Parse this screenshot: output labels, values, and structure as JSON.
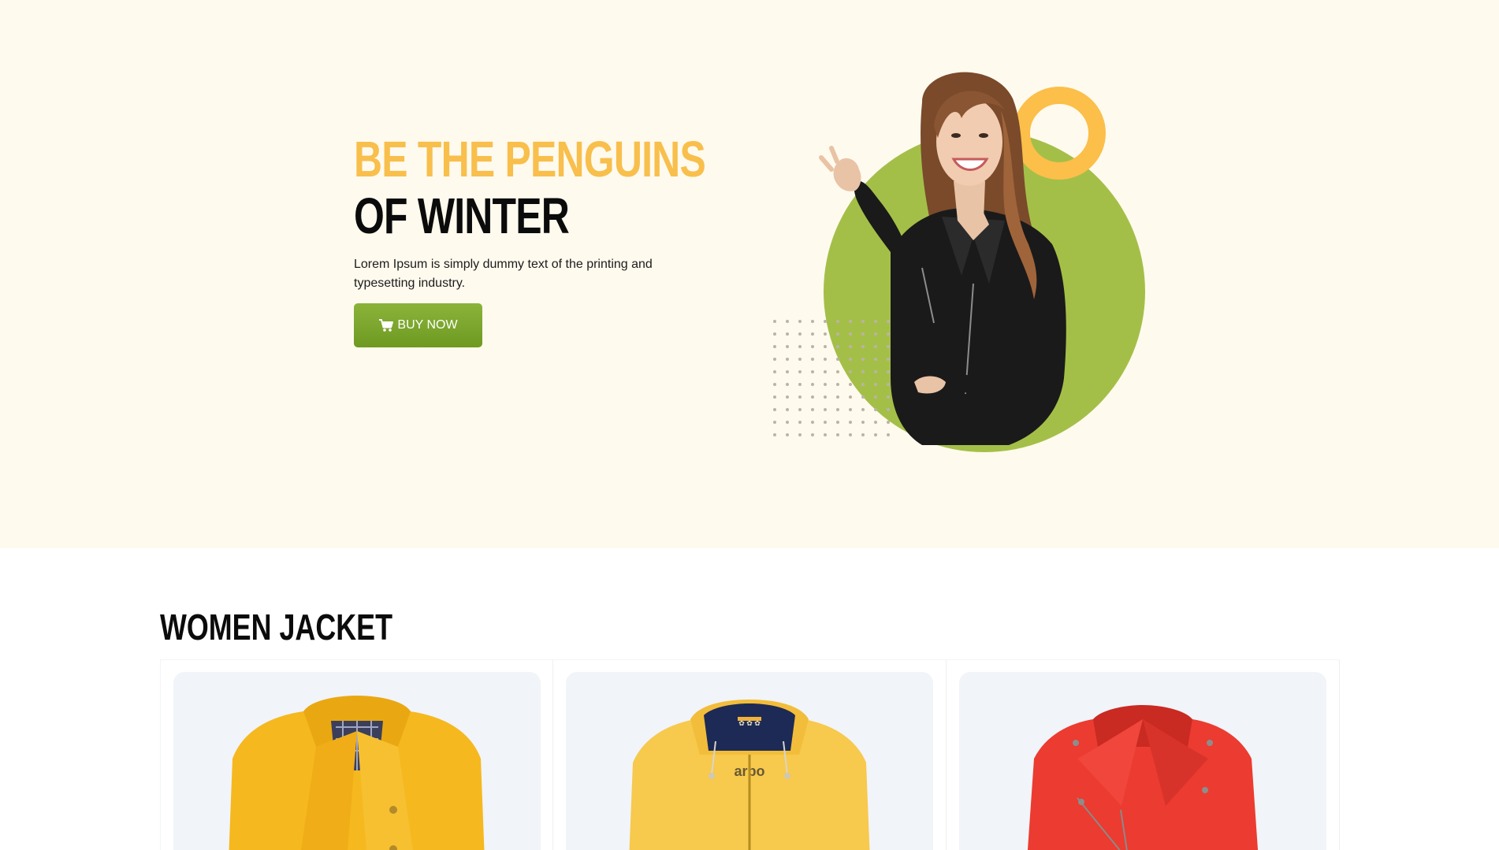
{
  "hero": {
    "title_line1": "BE THE PENGUINS",
    "title_line2": "OF WINTER",
    "description": "Lorem Ipsum is simply dummy text of the printing and typesetting industry.",
    "buy_button": {
      "label": "BUY NOW",
      "icon": "cart-icon"
    },
    "colors": {
      "background": "#fffaee",
      "accent": "#f8bf4c",
      "button_green": "#7aa52c",
      "circle_green": "#a4bf48",
      "ring_orange": "#fbbf4a"
    }
  },
  "products_section": {
    "title": "WOMEN JACKET",
    "items": [
      {
        "name": "yellow-wool-coat",
        "color": "#f5b81f"
      },
      {
        "name": "yellow-hooded-rain-jacket",
        "color": "#f7c94d"
      },
      {
        "name": "red-leather-jacket",
        "color": "#ec3b30"
      }
    ]
  }
}
